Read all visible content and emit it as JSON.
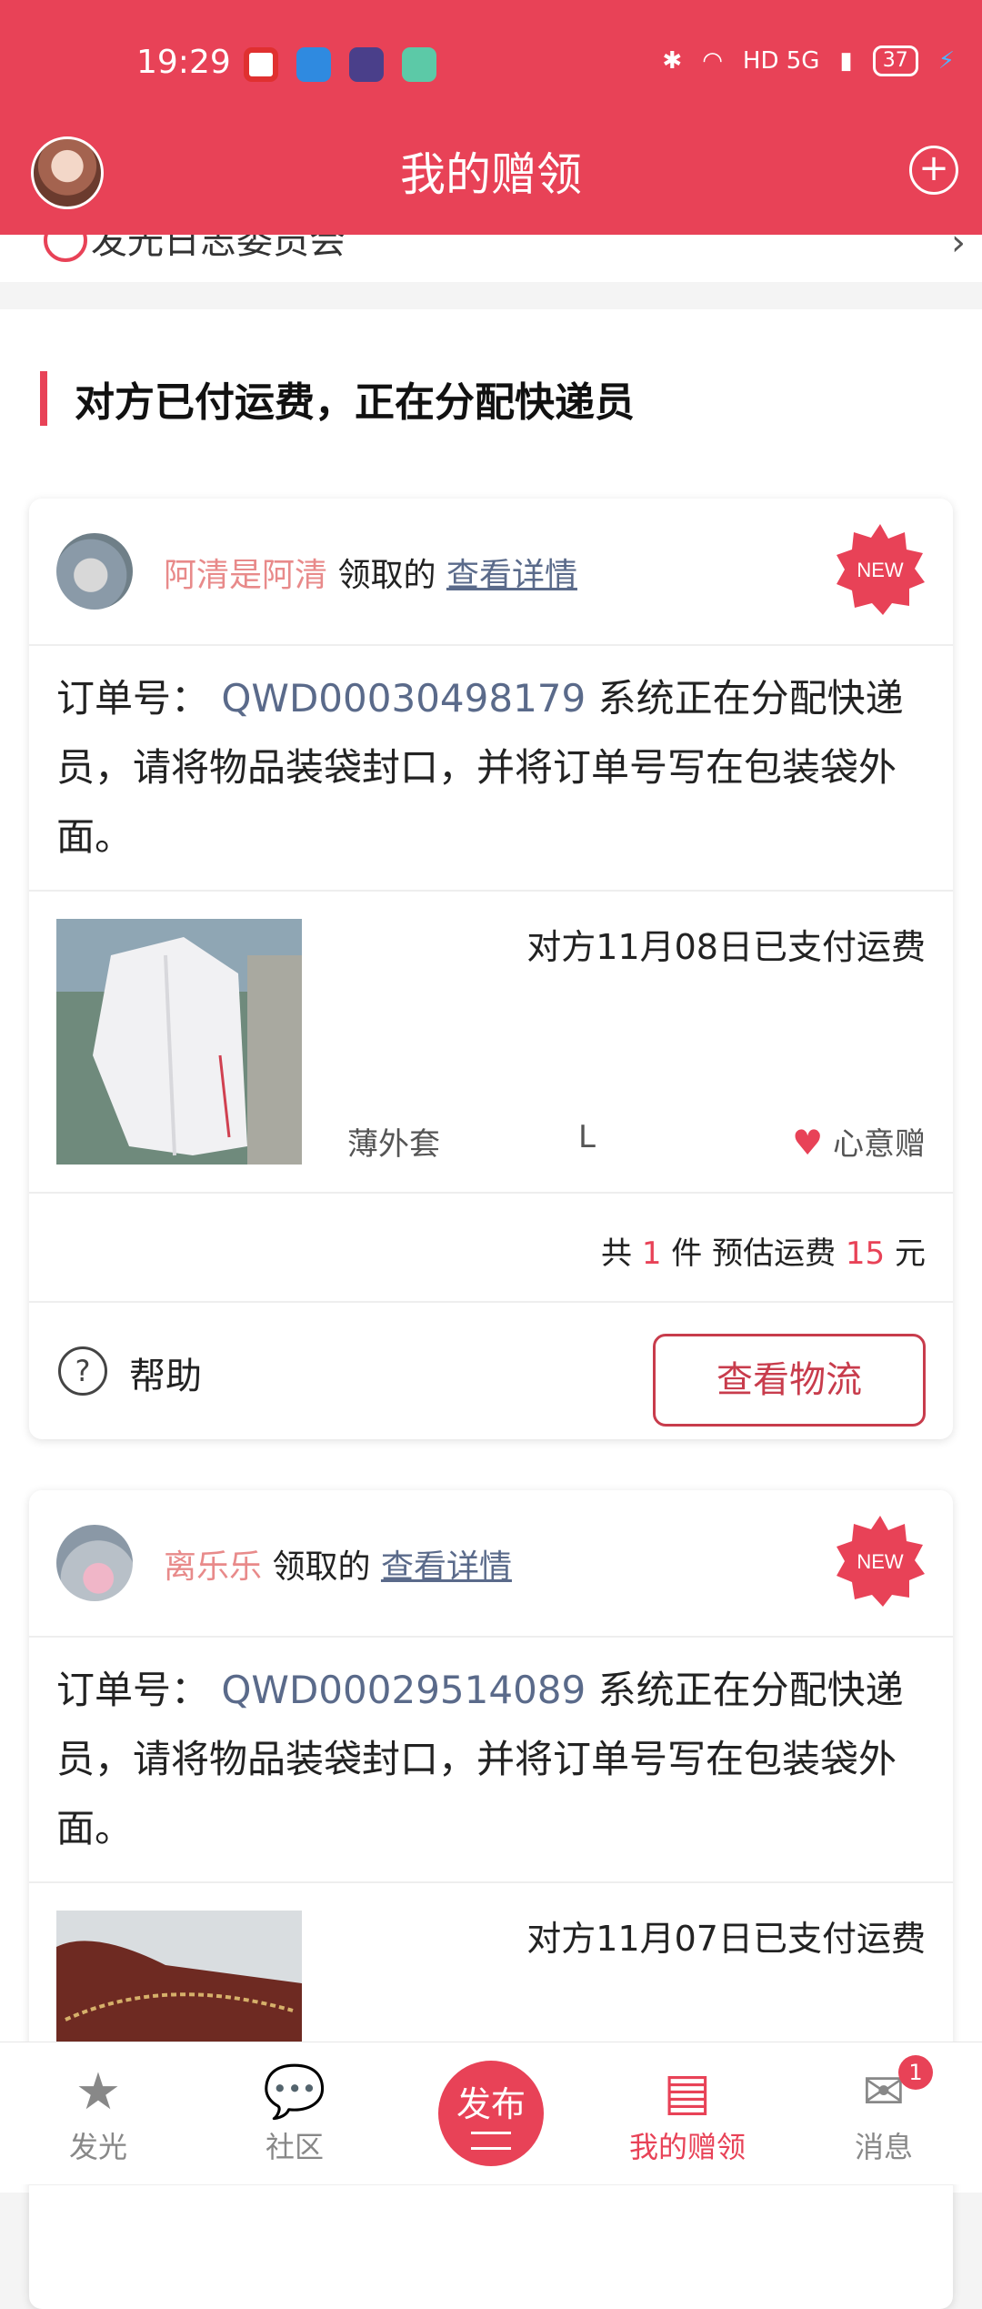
{
  "status_bar": {
    "time": "19:29",
    "network": "HD 5G",
    "battery": "37"
  },
  "header": {
    "title": "我的赠领"
  },
  "peek_row": {
    "text": "发光日志委员会"
  },
  "section": {
    "title": "对方已付运费，正在分配快递员"
  },
  "orders": [
    {
      "user": "阿清是阿清",
      "action": "领取的",
      "detail_link": "查看详情",
      "badge": "NEW",
      "order_label": "订单号：",
      "order_no": "QWD00030498179",
      "message": "系统正在分配快递员，请将物品装袋封口，并将订单号写在包装袋外面。",
      "paid_text": "对方11月08日已支付运费",
      "item_name": "薄外套",
      "item_size": "L",
      "item_tag": "心意赠",
      "count_prefix": "共",
      "count": "1",
      "count_suffix": "件 预估运费",
      "fee": "15",
      "fee_unit": "元",
      "help": "帮助",
      "track_button": "查看物流"
    },
    {
      "user": "离乐乐",
      "action": "领取的",
      "detail_link": "查看详情",
      "badge": "NEW",
      "order_label": "订单号：",
      "order_no": "QWD00029514089",
      "message": "系统正在分配快递员，请将物品装袋封口，并将订单号写在包装袋外面。",
      "paid_text": "对方11月07日已支付运费"
    }
  ],
  "bottom_nav": {
    "items": [
      {
        "label": "发光",
        "icon": "star-icon"
      },
      {
        "label": "社区",
        "icon": "chat-bubble-icon"
      },
      {
        "label": "我的赠领",
        "icon": "gift-box-icon"
      },
      {
        "label": "消息",
        "icon": "mail-icon"
      }
    ],
    "publish_label": "发布",
    "message_badge": "1"
  },
  "colors": {
    "brand": "#e84257",
    "link": "#5a6a8a",
    "username": "#e88a8a"
  }
}
